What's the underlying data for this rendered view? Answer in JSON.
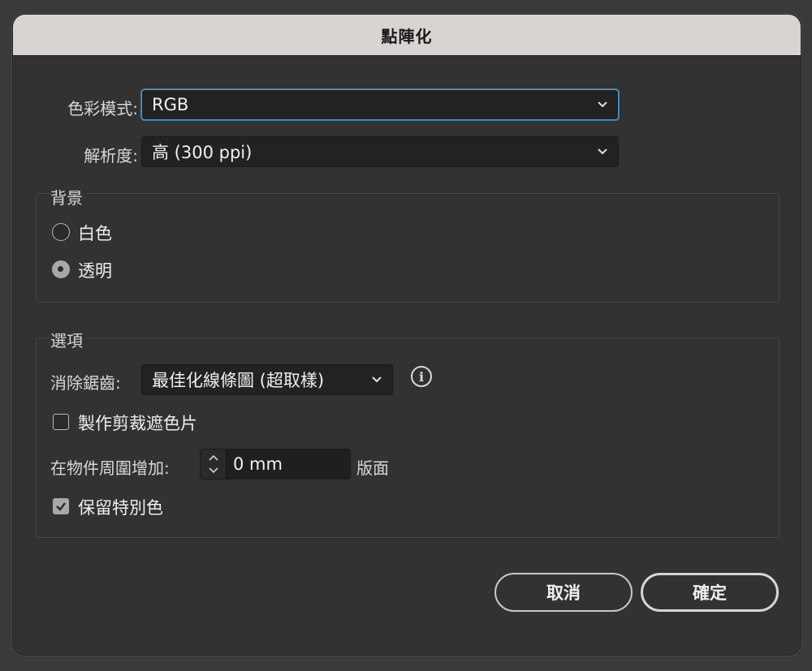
{
  "window": {
    "title": "點陣化"
  },
  "color_mode": {
    "label": "色彩模式:",
    "value": "RGB"
  },
  "resolution": {
    "label": "解析度:",
    "value": "高 (300 ppi)"
  },
  "background": {
    "title": "背景",
    "options": [
      {
        "label": "白色",
        "checked": false
      },
      {
        "label": "透明",
        "checked": true
      }
    ]
  },
  "options": {
    "title": "選項",
    "antialias": {
      "label": "消除鋸齒:",
      "value": "最佳化線條圖 (超取樣)",
      "info_icon": "info-icon"
    },
    "clipping_mask": {
      "label": "製作剪裁遮色片",
      "checked": false
    },
    "add_around": {
      "label": "在物件周圍增加:",
      "value": "0 mm",
      "suffix": "版面"
    },
    "preserve_spot": {
      "label": "保留特別色",
      "checked": true
    }
  },
  "buttons": {
    "cancel": "取消",
    "ok": "確定"
  }
}
